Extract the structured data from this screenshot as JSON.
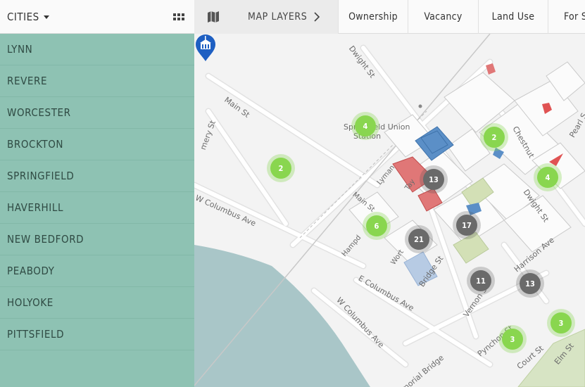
{
  "topbar": {
    "cities_label": "CITIES",
    "map_layers_label": "MAP LAYERS",
    "layer_tabs": [
      {
        "label": "Ownership"
      },
      {
        "label": "Vacancy"
      },
      {
        "label": "Land Use"
      },
      {
        "label": "For S"
      }
    ]
  },
  "sidebar": {
    "cities": [
      "LYNN",
      "REVERE",
      "WORCESTER",
      "BROCKTON",
      "SPRINGFIELD",
      "HAVERHILL",
      "NEW BEDFORD",
      "PEABODY",
      "HOLYOKE",
      "PITTSFIELD"
    ]
  },
  "map": {
    "pin_icon": "city-hall-pin-icon",
    "clusters": [
      {
        "count": "4",
        "style": "green"
      },
      {
        "count": "2",
        "style": "green"
      },
      {
        "count": "2",
        "style": "green"
      },
      {
        "count": "4",
        "style": "green"
      },
      {
        "count": "13",
        "style": "gray"
      },
      {
        "count": "6",
        "style": "green"
      },
      {
        "count": "21",
        "style": "gray"
      },
      {
        "count": "17",
        "style": "gray"
      },
      {
        "count": "11",
        "style": "gray"
      },
      {
        "count": "13",
        "style": "gray"
      },
      {
        "count": "3",
        "style": "green"
      },
      {
        "count": "3",
        "style": "green"
      }
    ],
    "streets": {
      "main_st": "Main St",
      "dwight_top": "Dwight St",
      "memory": "mery St",
      "springfield_union": "Springfield Union",
      "station": "Station",
      "w_columbus_1": "W Columbus Ave",
      "e_columbus": "E Columbus Ave",
      "w_columbus_2": "W Columbus Ave",
      "chestnut": "Chestnut",
      "pearl": "Pearl S",
      "dwight_right": "Dwight St",
      "harrison": "Harrison Ave",
      "vernon": "Vernon St",
      "bridge": "Bridge St",
      "pynchon": "Pynchon St",
      "court": "Court St",
      "elm": "Elm St",
      "memorial_bridge": "morial Bridge",
      "main_small": "Main St",
      "lyman": "Lyman",
      "hampden": "Hampd",
      "worthington": "Wort",
      "taylor": "Tay"
    }
  }
}
